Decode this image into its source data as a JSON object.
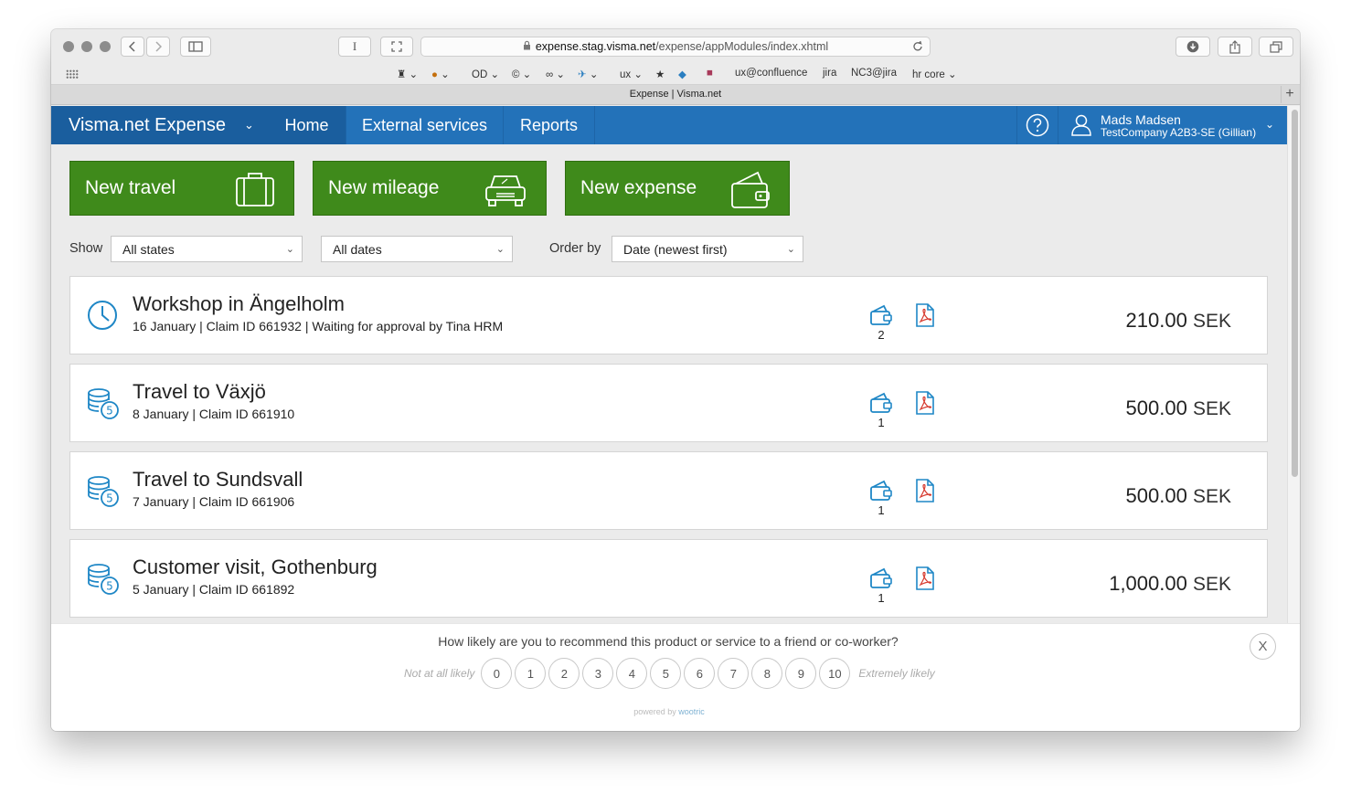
{
  "browser": {
    "url_domain": "expense.stag.visma.net",
    "url_path": "/expense/appModules/index.xhtml",
    "tab_title": "Expense | Visma.net",
    "text_cursor_button": "I",
    "favorites": [
      "OD",
      "ux",
      "ux@confluence",
      "jira",
      "NC3@jira",
      "hr core"
    ]
  },
  "app": {
    "brand": "Visma.net Expense",
    "nav": [
      "Home",
      "External services",
      "Reports"
    ],
    "user_name": "Mads Madsen",
    "user_company": "TestCompany A2B3-SE (Gillian)",
    "colors": {
      "header": "#2372b9",
      "header_dark": "#1a5e9e",
      "action": "#3f8a1b",
      "icon_blue": "#1f87c6"
    }
  },
  "actions": [
    {
      "label": "New travel",
      "icon": "suitcase-icon"
    },
    {
      "label": "New mileage",
      "icon": "car-icon"
    },
    {
      "label": "New expense",
      "icon": "wallet-icon"
    }
  ],
  "filters": {
    "show_label": "Show",
    "state": "All states",
    "dates": "All dates",
    "order_label": "Order by",
    "order": "Date (newest first)"
  },
  "claims": [
    {
      "title": "Workshop in Ängelholm",
      "meta": "16 January | Claim ID 661932 | Waiting for approval by Tina HRM",
      "receipts": "2",
      "amount": "210.00",
      "currency": "SEK",
      "status_icon": "clock-icon"
    },
    {
      "title": "Travel to Växjö",
      "meta": "8 January | Claim ID 661910",
      "receipts": "1",
      "amount": "500.00",
      "currency": "SEK",
      "status_icon": "coins-icon"
    },
    {
      "title": "Travel to Sundsvall",
      "meta": "7 January | Claim ID 661906",
      "receipts": "1",
      "amount": "500.00",
      "currency": "SEK",
      "status_icon": "coins-icon"
    },
    {
      "title": "Customer visit, Gothenburg",
      "meta": "5 January | Claim ID 661892",
      "receipts": "1",
      "amount": "1,000.00",
      "currency": "SEK",
      "status_icon": "coins-icon"
    }
  ],
  "survey": {
    "question": "How likely are you to recommend this product or service to a friend or co-worker?",
    "low_label": "Not at all likely",
    "high_label": "Extremely likely",
    "scale": [
      "0",
      "1",
      "2",
      "3",
      "4",
      "5",
      "6",
      "7",
      "8",
      "9",
      "10"
    ],
    "powered_prefix": "powered by",
    "powered_brand": "wootric",
    "close": "X"
  }
}
